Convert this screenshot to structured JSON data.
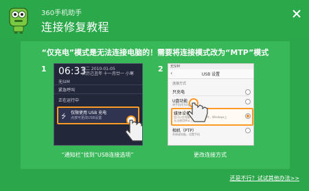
{
  "header": {
    "app_title": "360手机助手",
    "page_title": "连接修复教程"
  },
  "instruction": "“仅充电”模式是无法连接电脑的！需要将连接模式改为“MTP”模式",
  "steps": [
    {
      "number": "1",
      "caption": "“通知栏”找到“USB连接选项”",
      "phone": {
        "time": "06:33",
        "date_line1": "周二 2010-01-05",
        "date_line2": "农历己丑年 十一月廿一 小寒",
        "sim": "无SIM",
        "rows": [
          "紧急呼叫",
          "正在运行中"
        ],
        "notification_title": "仅限使用 USB 充电",
        "notification_desc": "点按可更改USB设置"
      }
    },
    {
      "number": "2",
      "caption": "更改连接方式",
      "phone": {
        "status": "无SIM",
        "title": "USB 设置",
        "section": "连接方式",
        "options": [
          {
            "label": "只充电",
            "desc": "",
            "selected": false
          },
          {
            "label": "U盘功能",
            "desc": "将手机作为U盘使用",
            "selected": false
          },
          {
            "label": "媒体设备（MTP）",
            "desc": "您可以在电脑中传输媒体文件，Windows上",
            "selected": true
          },
          {
            "label": "相机（PTP）",
            "desc": "",
            "selected": false
          }
        ],
        "option_extra": [
          "无法使用Mac上的",
          "系统或电脑，设置手机"
        ]
      }
    }
  ],
  "footer_link": "还是不行？试试其他办法>>",
  "colors": {
    "background": "#2ba64a",
    "panel": "#39b85a",
    "highlight": "#ff9a25"
  },
  "icons": [
    "mascot-logo",
    "close-icon",
    "usb-icon",
    "hand-pointer-icon"
  ]
}
